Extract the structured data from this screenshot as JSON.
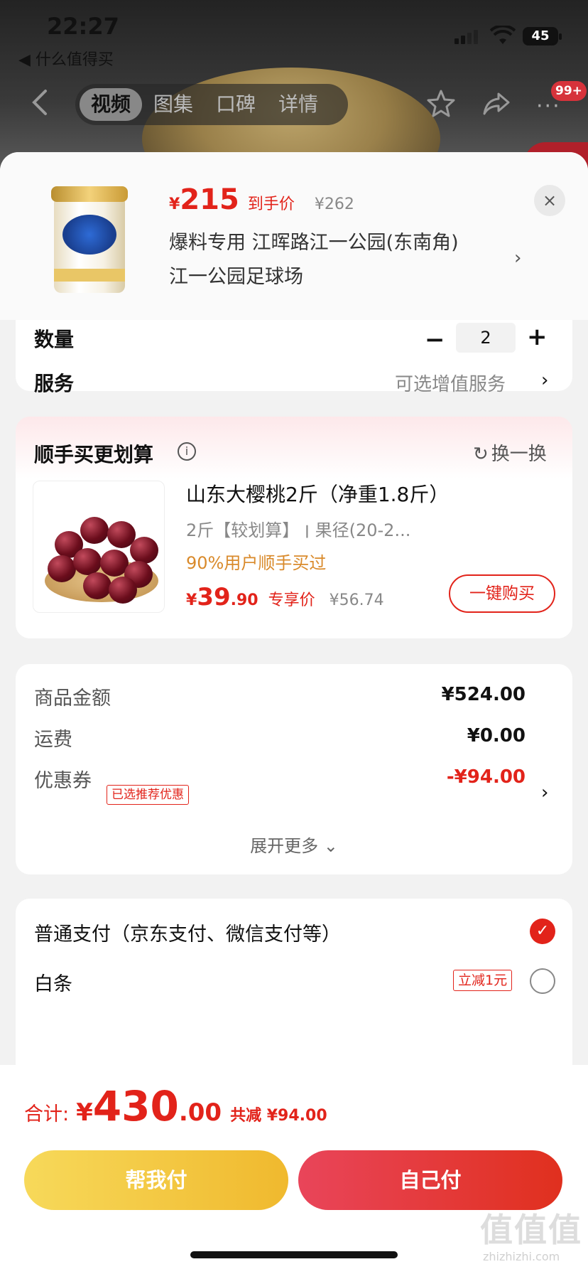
{
  "status_bar": {
    "time": "22:27",
    "back_app": "◀ 什么值得买",
    "battery": "45"
  },
  "nav": {
    "tabs": [
      "视频",
      "图集",
      "口碑",
      "详情"
    ],
    "badge": "99+",
    "more": "···"
  },
  "product": {
    "price_symbol": "¥",
    "price": "215",
    "price_label": "到手价",
    "original_price": "¥262",
    "address_line1": "爆料专用  江晖路江一公园(东南角)",
    "address_line2": "江一公园足球场",
    "close": "×"
  },
  "quantity": {
    "label": "数量",
    "minus": "−",
    "value": "2",
    "plus": "+"
  },
  "service": {
    "label": "服务",
    "value": "可选增值服务",
    "arrow": "›"
  },
  "upsell": {
    "title": "顺手买更划算",
    "info": "i",
    "swap_icon": "↻",
    "swap": "换一换",
    "name": "山东大樱桃2斤（净重1.8斤）",
    "spec": "2斤【较划算】 ׀ 果径(20-2...",
    "tag": "90%用户顺手买过",
    "price_symbol": "¥",
    "price_int": "39",
    "price_dec": ".90",
    "price_label": "专享价",
    "original_price": "¥56.74",
    "buy_button": "一键购买"
  },
  "summary": {
    "goods_label": "商品金额",
    "goods_value": "¥524.00",
    "shipping_label": "运费",
    "shipping_value": "¥0.00",
    "coupon_label": "优惠券",
    "coupon_tag": "已选推荐优惠",
    "coupon_value": "-¥94.00",
    "arrow": "›",
    "expand": "展开更多 ⌄"
  },
  "payment": {
    "normal": "普通支付（京东支付、微信支付等）",
    "baitiao": "白条",
    "baitiao_tag": "立减1元",
    "check": "✓"
  },
  "footer": {
    "total_label": "合计:",
    "total_symbol": "¥",
    "total_int": "430",
    "total_dec": ".00",
    "saved": "共减 ¥94.00",
    "help_pay": "帮我付",
    "self_pay": "自己付"
  },
  "watermark": {
    "main": "值值值",
    "sub": "zhizhizhi.com"
  }
}
